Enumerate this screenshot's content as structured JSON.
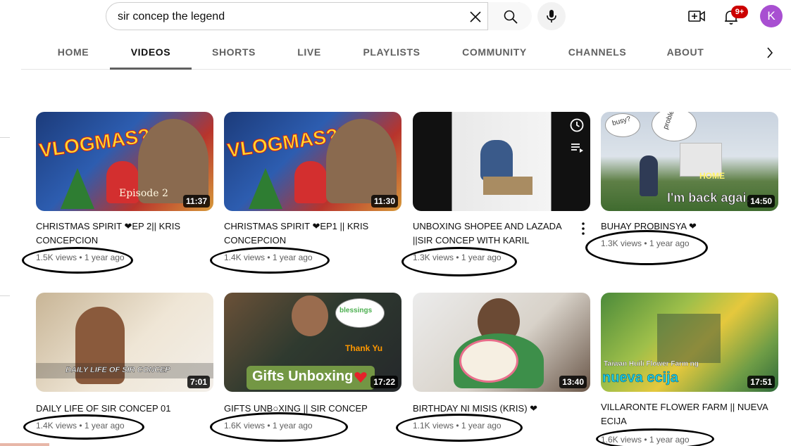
{
  "search": {
    "query": "sir concep the legend"
  },
  "header": {
    "notification_count": "9+",
    "avatar_letter": "K"
  },
  "tabs": [
    {
      "label": "HOME"
    },
    {
      "label": "VIDEOS"
    },
    {
      "label": "SHORTS"
    },
    {
      "label": "LIVE"
    },
    {
      "label": "PLAYLISTS"
    },
    {
      "label": "COMMUNITY"
    },
    {
      "label": "CHANNELS"
    },
    {
      "label": "ABOUT"
    }
  ],
  "active_tab": "VIDEOS",
  "videos": [
    {
      "title": "CHRISTMAS SPIRIT ❤EP 2|| KRIS CONCEPCION",
      "meta": "1.5K views • 1 year ago",
      "duration": "11:37",
      "overlay": "VLOGMAS?!",
      "overlay2": "Episode 2"
    },
    {
      "title": "CHRISTMAS SPIRIT ❤EP1 || KRIS CONCEPCION",
      "meta": "1.4K views • 1 year ago",
      "duration": "11:30",
      "overlay": "VLOGMAS?!"
    },
    {
      "title": "UNBOXING SHOPEE AND LAZADA ||SIR CONCEP WITH KARIL",
      "meta": "1.3K views • 1 year ago"
    },
    {
      "title": "BUHAY PROBINSYA ❤",
      "meta": "1.3K views • 1 year ago",
      "duration": "14:50",
      "overlay": "I'm back agai...",
      "overlay2": "HOME",
      "overlay3": "busy?",
      "overlay4": "problem"
    },
    {
      "title": "DAILY LIFE OF SIR CONCEP 01",
      "meta": "1.4K views • 1 year ago",
      "duration": "7:01",
      "overlay": "DAILY LIFE OF SIR CONCEP"
    },
    {
      "title": "GIFTS UNB○XING || SIR CONCEP",
      "meta": "1.6K views • 1 year ago",
      "duration": "17:22",
      "overlay": "Gifts Unboxing",
      "overlay2": "blessings",
      "overlay3": "Thank Yu"
    },
    {
      "title": "BIRTHDAY NI MISIS (KRIS) ❤",
      "meta": "1.1K views • 1 year ago",
      "duration": "13:40"
    },
    {
      "title": "VILLARONTE FLOWER FARM || NUEVA ECIJA",
      "meta": "1.6K views • 1 year ago",
      "duration": "17:51",
      "overlay": "nueva ecija",
      "overlay2": "Taiwan Huili Flower Farm ng"
    }
  ],
  "colors": {
    "accent_red": "#cc0000",
    "avatar": "#a84fd1",
    "meta_gray": "#606060"
  }
}
